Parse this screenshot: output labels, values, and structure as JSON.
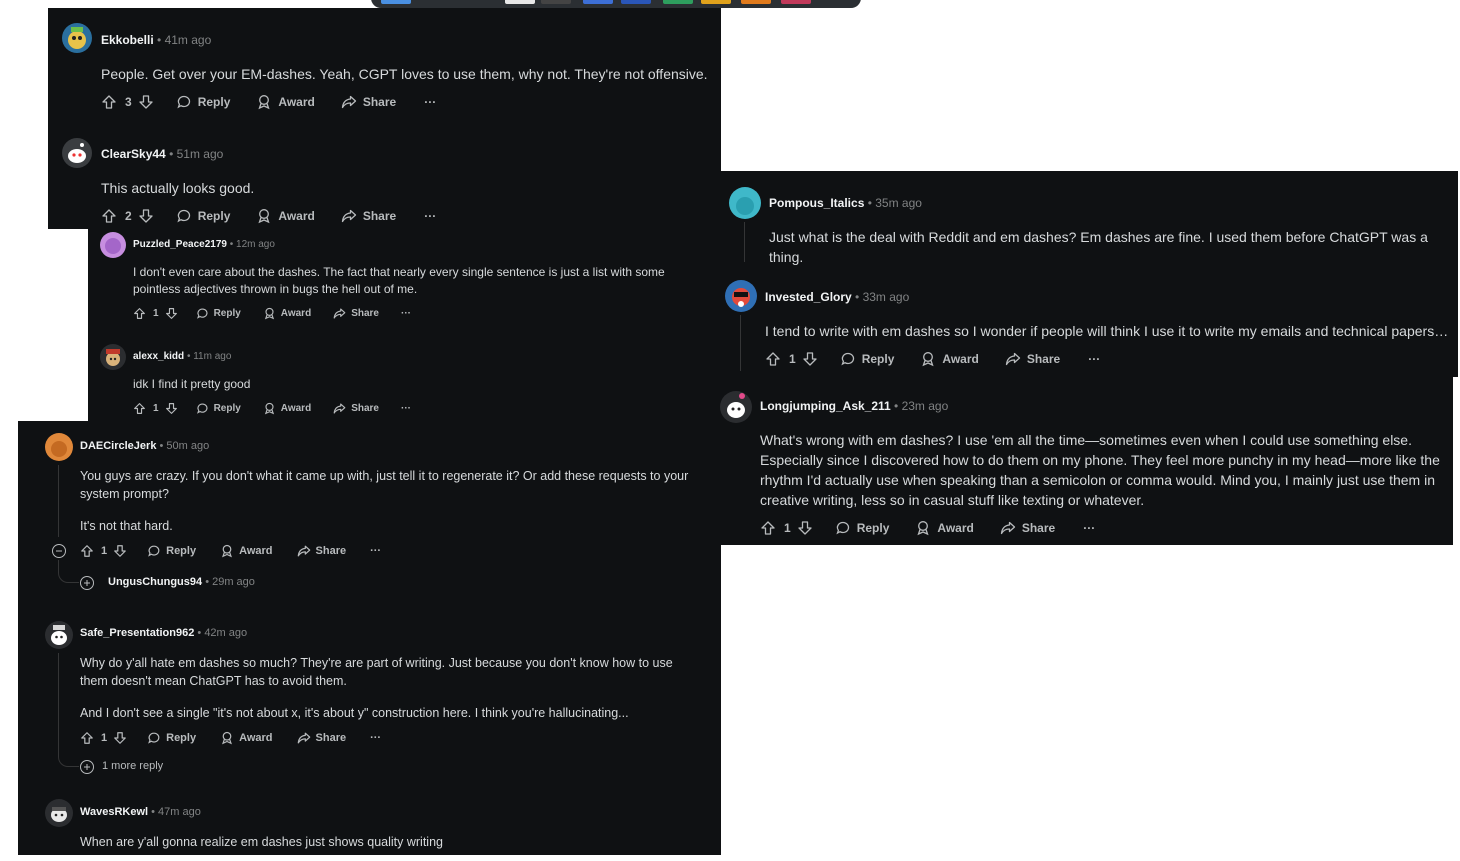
{
  "actions": {
    "reply": "Reply",
    "award": "Award",
    "share": "Share",
    "more": "···"
  },
  "c_ekko": {
    "user": "Ekkobelli",
    "time": "• 41m ago",
    "body": "People. Get over your EM-dashes. Yeah, CGPT loves to use them, why not. They're not offensive.",
    "votes": "3"
  },
  "c_clear": {
    "user": "ClearSky44",
    "time": "• 51m ago",
    "body": "This actually looks good.",
    "votes": "2"
  },
  "c_puzzled": {
    "user": "Puzzled_Peace2179",
    "time": "• 12m ago",
    "body": "I don't even care about the dashes. The fact that nearly every single sentence is just a list with some pointless adjectives thrown in bugs the hell out of me.",
    "votes": "1"
  },
  "c_alexx": {
    "user": "alexx_kidd",
    "time": "• 11m ago",
    "body": "idk I find it pretty good",
    "votes": "1"
  },
  "c_dae": {
    "user": "DAECircleJerk",
    "time": "• 50m ago",
    "body1": "You guys are crazy. If you don't what it came up with, just tell it to regenerate it? Or add these requests to your system prompt?",
    "body2": "It's not that hard.",
    "votes": "1"
  },
  "c_ungus": {
    "user": "UngusChungus94",
    "time": "• 29m ago"
  },
  "c_safe": {
    "user": "Safe_Presentation962",
    "time": "• 42m ago",
    "body1": "Why do y'all hate em dashes so much? They're are part of writing. Just because you don't know how to use them doesn't mean ChatGPT has to avoid them.",
    "body2": "And I don't see a single \"it's not about x, it's about y\" construction here. I think you're hallucinating...",
    "votes": "1",
    "more_replies": "1 more reply"
  },
  "c_waves": {
    "user": "WavesRKewl",
    "time": "• 47m ago",
    "body": "When are y'all gonna realize em dashes just shows quality writing"
  },
  "c_pompous": {
    "user": "Pompous_Italics",
    "time": "• 35m ago",
    "body": "Just what is the deal with Reddit and em dashes? Em dashes are fine. I used them before ChatGPT was a thing."
  },
  "c_invested": {
    "user": "Invested_Glory",
    "time": "• 33m ago",
    "body": "I tend to write with em dashes so I wonder if people will think I use it to write my emails and technical papers…",
    "votes": "1"
  },
  "c_long": {
    "user": "Longjumping_Ask_211",
    "time": "• 23m ago",
    "body": "What's wrong with em dashes? I use 'em all the time—sometimes even when I could use something else. Especially since I discovered how to do them on my phone. They feel more punchy in my head—more like the rhythm I'd actually use when speaking than a semicolon or comma would. Mind you, I mainly just use them in creative writing, less so in casual stuff like texting or whatever.",
    "votes": "1"
  },
  "colors": {
    "panel": "#0f1113",
    "text": "#d7dadc",
    "muted": "#818384",
    "username": "#f2f4f5"
  }
}
